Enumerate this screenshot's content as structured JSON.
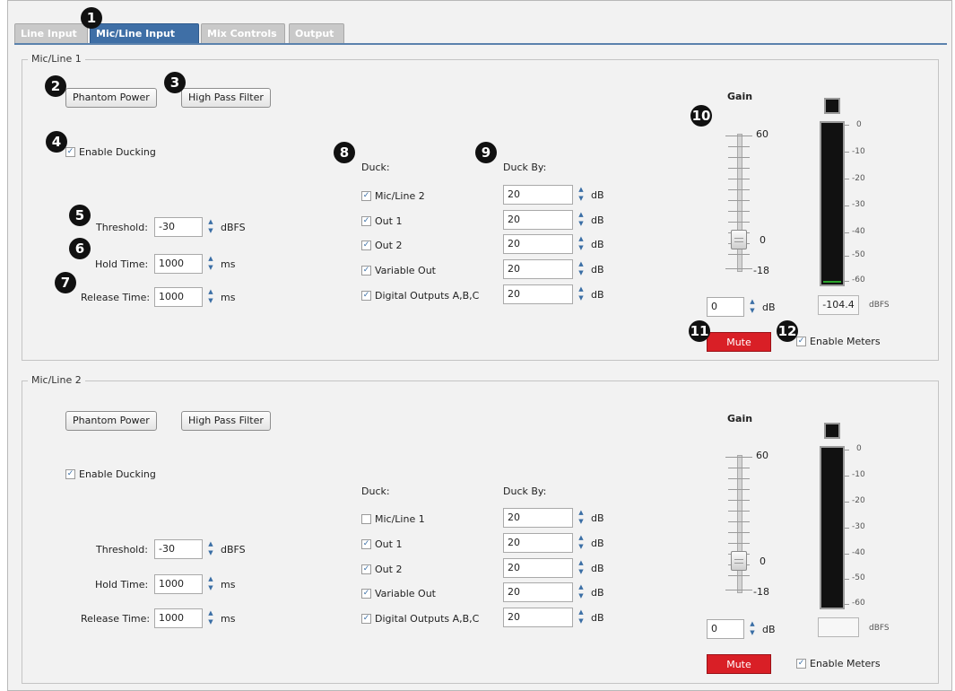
{
  "tabs": [
    "Line Input",
    "Mic/Line Input",
    "Mix Controls",
    "Output"
  ],
  "active_tab": "Mic/Line Input",
  "callouts": [
    "1",
    "2",
    "3",
    "4",
    "5",
    "6",
    "7",
    "8",
    "9",
    "10",
    "11",
    "12"
  ],
  "channels": [
    {
      "title": "Mic/Line 1",
      "phantom_power": "Phantom Power",
      "high_pass_filter": "High Pass Filter",
      "enable_ducking": {
        "label": "Enable Ducking",
        "checked": true
      },
      "threshold": {
        "label": "Threshold:",
        "value": "-30",
        "unit": "dBFS"
      },
      "hold_time": {
        "label": "Hold Time:",
        "value": "1000",
        "unit": "ms"
      },
      "release_time": {
        "label": "Release Time:",
        "value": "1000",
        "unit": "ms"
      },
      "duck_header": "Duck:",
      "duck_by_header": "Duck By:",
      "duck_rows": [
        {
          "label": "Mic/Line 2",
          "checked": true,
          "value": "20",
          "unit": "dB"
        },
        {
          "label": "Out 1",
          "checked": true,
          "value": "20",
          "unit": "dB"
        },
        {
          "label": "Out 2",
          "checked": true,
          "value": "20",
          "unit": "dB"
        },
        {
          "label": "Variable Out",
          "checked": true,
          "value": "20",
          "unit": "dB"
        },
        {
          "label": "Digital Outputs A,B,C",
          "checked": true,
          "value": "20",
          "unit": "dB"
        }
      ],
      "gain": {
        "title": "Gain",
        "max_label": "60",
        "zero_label": "0",
        "min_label": "-18",
        "value": "0",
        "unit": "dB"
      },
      "meter": {
        "scale": [
          "0",
          "-10",
          "-20",
          "-30",
          "-40",
          "-50",
          "-60"
        ],
        "readout": "-104.4",
        "unit": "dBFS",
        "level_fraction": 0.01
      },
      "mute": "Mute",
      "enable_meters": {
        "label": "Enable Meters",
        "checked": true
      }
    },
    {
      "title": "Mic/Line 2",
      "phantom_power": "Phantom Power",
      "high_pass_filter": "High Pass Filter",
      "enable_ducking": {
        "label": "Enable Ducking",
        "checked": true
      },
      "threshold": {
        "label": "Threshold:",
        "value": "-30",
        "unit": "dBFS"
      },
      "hold_time": {
        "label": "Hold Time:",
        "value": "1000",
        "unit": "ms"
      },
      "release_time": {
        "label": "Release Time:",
        "value": "1000",
        "unit": "ms"
      },
      "duck_header": "Duck:",
      "duck_by_header": "Duck By:",
      "duck_rows": [
        {
          "label": "Mic/Line 1",
          "checked": false,
          "value": "20",
          "unit": "dB"
        },
        {
          "label": "Out 1",
          "checked": true,
          "value": "20",
          "unit": "dB"
        },
        {
          "label": "Out 2",
          "checked": true,
          "value": "20",
          "unit": "dB"
        },
        {
          "label": "Variable Out",
          "checked": true,
          "value": "20",
          "unit": "dB"
        },
        {
          "label": "Digital Outputs A,B,C",
          "checked": true,
          "value": "20",
          "unit": "dB"
        }
      ],
      "gain": {
        "title": "Gain",
        "max_label": "60",
        "zero_label": "0",
        "min_label": "-18",
        "value": "0",
        "unit": "dB"
      },
      "meter": {
        "scale": [
          "0",
          "-10",
          "-20",
          "-30",
          "-40",
          "-50",
          "-60"
        ],
        "readout": "",
        "unit": "dBFS",
        "level_fraction": 0
      },
      "mute": "Mute",
      "enable_meters": {
        "label": "Enable Meters",
        "checked": true
      }
    }
  ],
  "colors": {
    "tab_active": "#3f6fa6",
    "mute": "#d91f26",
    "meter_fill": "#2aa32a"
  }
}
